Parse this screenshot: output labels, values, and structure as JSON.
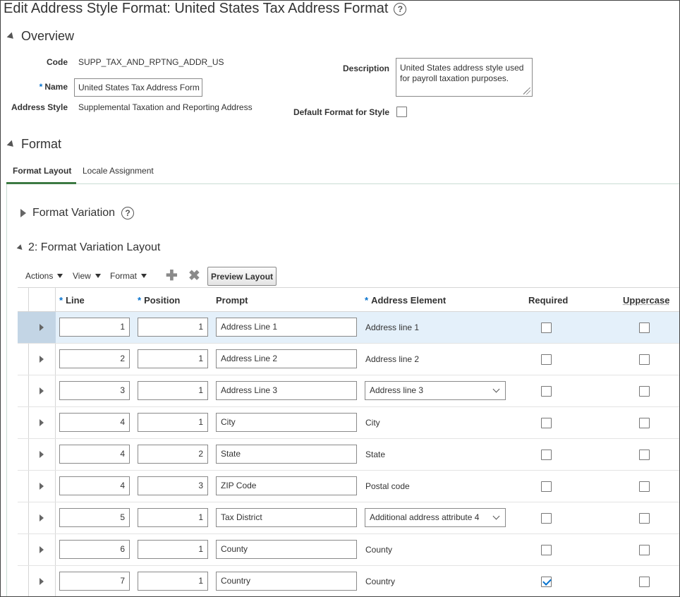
{
  "page": {
    "title": "Edit Address Style Format: United States Tax Address Format"
  },
  "overview": {
    "heading": "Overview",
    "code_label": "Code",
    "code_value": "SUPP_TAX_AND_RPTNG_ADDR_US",
    "name_label": "Name",
    "name_value": "United States Tax Address Form",
    "address_style_label": "Address Style",
    "address_style_value": "Supplemental Taxation and Reporting Address",
    "description_label": "Description",
    "description_value": "United States address style used for payroll taxation purposes.",
    "default_format_label": "Default Format for Style",
    "default_format_checked": false
  },
  "format": {
    "heading": "Format",
    "tabs": [
      {
        "label": "Format Layout",
        "active": true
      },
      {
        "label": "Locale Assignment",
        "active": false
      }
    ],
    "variation_heading": "Format Variation",
    "layout_heading": "2: Format Variation Layout",
    "toolbar": {
      "actions_label": "Actions",
      "view_label": "View",
      "format_label": "Format",
      "preview_label": "Preview Layout"
    },
    "columns": {
      "line": "Line",
      "position": "Position",
      "prompt": "Prompt",
      "address_element": "Address Element",
      "required": "Required",
      "uppercase": "Uppercase"
    },
    "rows": [
      {
        "line": "1",
        "position": "1",
        "prompt": "Address Line 1",
        "element": "Address line 1",
        "element_dropdown": false,
        "required": false,
        "uppercase": false,
        "selected": true
      },
      {
        "line": "2",
        "position": "1",
        "prompt": "Address Line 2",
        "element": "Address line 2",
        "element_dropdown": false,
        "required": false,
        "uppercase": false,
        "selected": false
      },
      {
        "line": "3",
        "position": "1",
        "prompt": "Address Line 3",
        "element": "Address line 3",
        "element_dropdown": true,
        "required": false,
        "uppercase": false,
        "selected": false
      },
      {
        "line": "4",
        "position": "1",
        "prompt": "City",
        "element": "City",
        "element_dropdown": false,
        "required": false,
        "uppercase": false,
        "selected": false
      },
      {
        "line": "4",
        "position": "2",
        "prompt": "State",
        "element": "State",
        "element_dropdown": false,
        "required": false,
        "uppercase": false,
        "selected": false
      },
      {
        "line": "4",
        "position": "3",
        "prompt": "ZIP Code",
        "element": "Postal code",
        "element_dropdown": false,
        "required": false,
        "uppercase": false,
        "selected": false
      },
      {
        "line": "5",
        "position": "1",
        "prompt": "Tax District",
        "element": "Additional address attribute 4",
        "element_dropdown": true,
        "required": false,
        "uppercase": false,
        "selected": false
      },
      {
        "line": "6",
        "position": "1",
        "prompt": "County",
        "element": "County",
        "element_dropdown": false,
        "required": false,
        "uppercase": false,
        "selected": false
      },
      {
        "line": "7",
        "position": "1",
        "prompt": "Country",
        "element": "Country",
        "element_dropdown": false,
        "required": true,
        "uppercase": false,
        "selected": false
      }
    ]
  },
  "colors": {
    "accent": "#0572ce",
    "tab_underline": "#3d7a43",
    "selected_row": "#e4f0fa"
  }
}
